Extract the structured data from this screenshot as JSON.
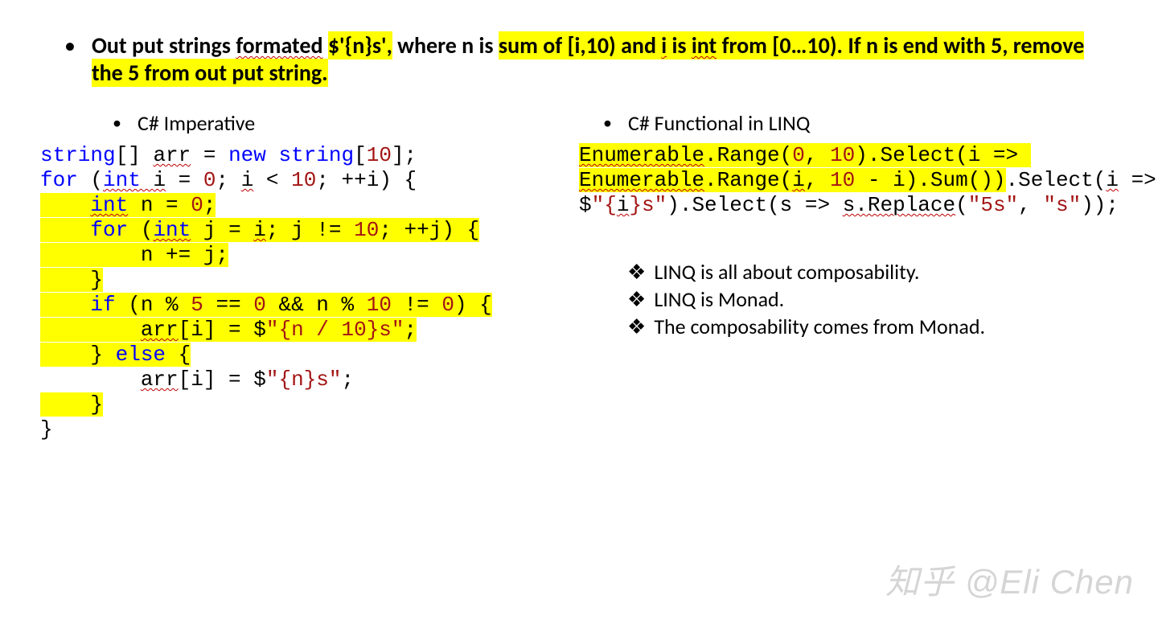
{
  "headline": {
    "pre": "Out put strings ",
    "u1": "formated",
    "sp1": " ",
    "hl1": "$'{n}s',",
    "mid1": " where n is ",
    "hl2_a": "sum of [i,10) and ",
    "hl2_u": "i",
    "hl2_b": " is ",
    "hl2_u2": "int",
    "hl2_c": " from [0…10). ",
    "hl3": "If n is end with 5, remove the 5 from out put string."
  },
  "left_title": "C# Imperative",
  "right_title": "C# Functional in LINQ",
  "code_left": {
    "l1": {
      "a": "string",
      "b": "[] ",
      "c": "arr",
      "d": " = ",
      "e": "new ",
      "f": "string",
      "g": "[",
      "h": "10",
      "i": "];"
    },
    "l2": {
      "a": "for ",
      "b": "(",
      "c": "int ",
      "d": "i",
      "e": " = ",
      "f": "0",
      "g": "; ",
      "h": "i",
      "i": " < ",
      "j": "10",
      "k": "; ++i) {"
    },
    "l3": {
      "a": "    ",
      "b": "int",
      "c": " n = ",
      "d": "0",
      "e": ";"
    },
    "l4": {
      "a": "    ",
      "b": "for ",
      "c": "(",
      "d": "int",
      "e": " j = ",
      "f": "i",
      "g": "; j != ",
      "h": "10",
      "i": "; ++j) {"
    },
    "l5": {
      "a": "        n += j;"
    },
    "l6": {
      "a": "    }"
    },
    "l7": {
      "a": "    ",
      "b": "if ",
      "c": "(n % ",
      "d": "5",
      "e": " == ",
      "f": "0",
      "g": " && n % ",
      "h": "10",
      "i": " != ",
      "j": "0",
      "k": ") {"
    },
    "l8": {
      "a": "        ",
      "b": "arr",
      "c": "[i] = $",
      "d": "\"{n / ",
      "e": "10",
      "f": "}s\"",
      "g": ";"
    },
    "l9": {
      "a": "    } ",
      "b": "else ",
      "c": "{"
    },
    "l10": {
      "a": "        ",
      "b": "arr",
      "c": "[i] = $",
      "d": "\"{n}s\"",
      "e": ";"
    },
    "l11": {
      "a": "    }"
    },
    "l12": {
      "a": "}"
    }
  },
  "code_right": {
    "l1": {
      "a": "Enumerable",
      "b": ".Range(",
      "c": "0",
      "d": ", ",
      "e": "10",
      "f": ")",
      "g": ".Select(i => "
    },
    "l2": {
      "a": "Enumerable",
      "b": ".Range(",
      "c": "i",
      "d": ", ",
      "e": "10",
      "f": " - i).Sum())",
      "g": ".Select(",
      "h": "i",
      "i": " => "
    },
    "l3": {
      "a": "$",
      "b": "\"{",
      "c": "i",
      "d": "}s\"",
      "e": ").Select(s => ",
      "f": "s.Replace",
      "g": "(",
      "h": "\"5s\"",
      "i": ", ",
      "j": "\"s\"",
      "k": "));"
    }
  },
  "notes": [
    "LINQ is all about composability.",
    "LINQ is Monad.",
    "The composability comes from Monad."
  ],
  "watermark": "知乎 @Eli Chen"
}
